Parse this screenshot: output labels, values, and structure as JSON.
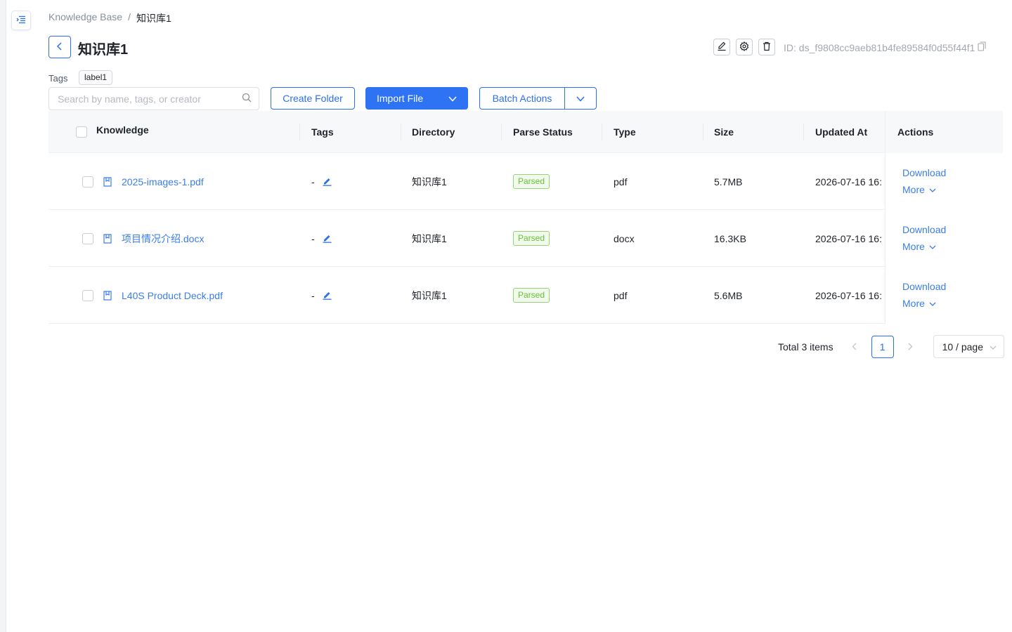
{
  "breadcrumb": {
    "root": "Knowledge Base",
    "separator": "/",
    "current": "知识库1"
  },
  "header": {
    "title": "知识库1",
    "id_text": "ID: ds_f9808cc9aeb81b4fe89584f0d55f44f1"
  },
  "tags": {
    "label": "Tags",
    "chips": [
      "label1"
    ]
  },
  "toolbar": {
    "search_placeholder": "Search by name, tags, or creator",
    "create_folder": "Create Folder",
    "import_file": "Import File",
    "batch_actions": "Batch Actions"
  },
  "table": {
    "columns": {
      "knowledge": "Knowledge",
      "tags": "Tags",
      "directory": "Directory",
      "parse_status": "Parse Status",
      "type": "Type",
      "size": "Size",
      "updated_at": "Updated At",
      "actions": "Actions"
    },
    "rows": [
      {
        "name": "2025-images-1.pdf",
        "tags": "-",
        "directory": "知识库1",
        "status": "Parsed",
        "type": "pdf",
        "size": "5.7MB",
        "updated": "2026-07-16 16:",
        "download": "Download",
        "more": "More"
      },
      {
        "name": "项目情况介绍.docx",
        "tags": "-",
        "directory": "知识库1",
        "status": "Parsed",
        "type": "docx",
        "size": "16.3KB",
        "updated": "2026-07-16 16:",
        "download": "Download",
        "more": "More"
      },
      {
        "name": "L40S Product Deck.pdf",
        "tags": "-",
        "directory": "知识库1",
        "status": "Parsed",
        "type": "pdf",
        "size": "5.6MB",
        "updated": "2026-07-16 16:",
        "download": "Download",
        "more": "More"
      }
    ]
  },
  "pagination": {
    "total": "Total 3 items",
    "current_page": "1",
    "page_size": "10 / page"
  },
  "colors": {
    "primary": "#2f73f5",
    "link": "#3a7ee8",
    "success": "#67c23a"
  },
  "icons": [
    "menu-toggle-icon",
    "back-arrow-icon",
    "edit-icon",
    "settings-icon",
    "delete-icon",
    "copy-icon",
    "search-icon",
    "chevron-down-icon",
    "file-icon",
    "pencil-icon",
    "chevron-left-icon",
    "chevron-right-icon"
  ]
}
